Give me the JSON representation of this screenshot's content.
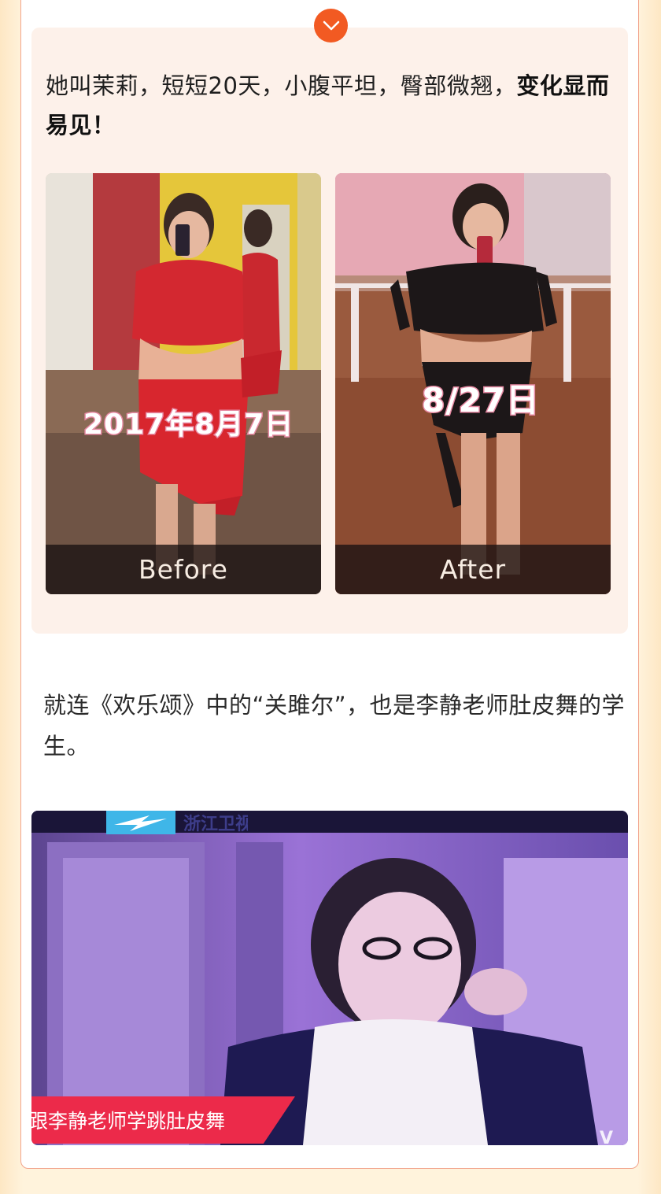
{
  "intro": {
    "text_normal": "她叫茉莉，短短20天，小腹平坦，臀部微翘，",
    "text_bold": "变化显而易见！"
  },
  "photos": {
    "before": {
      "caption": "Before",
      "date_stamp": "2017年8月7日"
    },
    "after": {
      "caption": "After",
      "date_stamp": "8/27日"
    }
  },
  "paragraph": "就连《欢乐颂》中的“关雎尔”，也是李静老师肚皮舞的学生。",
  "tv_clip": {
    "subtitle": "跟李静老师学跳肚皮舞",
    "channel": "浙江卫视",
    "corner_logo": "V"
  },
  "icons": {
    "top_badge": "chevron-down-icon"
  },
  "colors": {
    "accent": "#f25a22",
    "panel_bg": "#fdf1ea",
    "card_border": "#f2a48c",
    "subtitle_red": "#ec2a4a"
  }
}
